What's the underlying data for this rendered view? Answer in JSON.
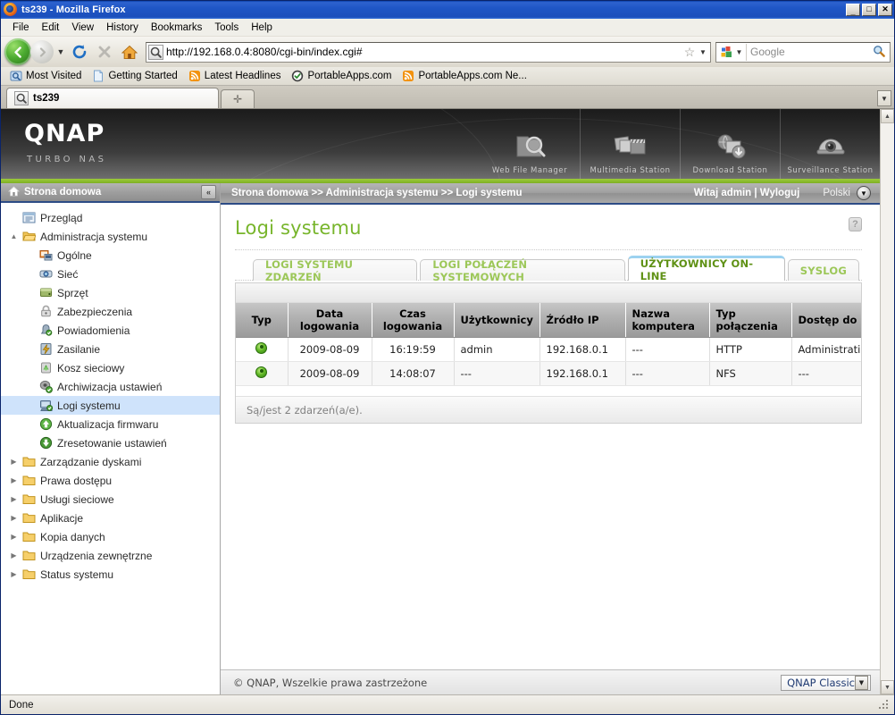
{
  "window": {
    "title": "ts239 - Mozilla Firefox",
    "minimize": "_",
    "maximize": "□",
    "close": "✕"
  },
  "menu": [
    "File",
    "Edit",
    "View",
    "History",
    "Bookmarks",
    "Tools",
    "Help"
  ],
  "toolbar": {
    "back": "◀",
    "forward": "▶",
    "history_arrow": "▼",
    "reload": "⟳",
    "stop": "✕",
    "home": "home-icon",
    "url": "http://192.168.0.4:8080/cgi-bin/index.cgi#",
    "star": "☆",
    "url_dropdown": "▼",
    "search_engine": "Google",
    "search_dropdown": "▼",
    "search_placeholder": "Google"
  },
  "bookmarks": [
    {
      "label": "Most Visited",
      "icon": "magnifier-folder-icon"
    },
    {
      "label": "Getting Started",
      "icon": "page-icon"
    },
    {
      "label": "Latest Headlines",
      "icon": "rss-icon"
    },
    {
      "label": "PortableApps.com",
      "icon": "check-circle-icon"
    },
    {
      "label": "PortableApps.com Ne...",
      "icon": "rss-icon"
    }
  ],
  "browser_tabs": {
    "active": "ts239",
    "new_tab": "✛",
    "list_arrow": "▼"
  },
  "qnap": {
    "logo": "QNAP",
    "tagline": "TURBO NAS",
    "apps": [
      {
        "label": "Web File Manager",
        "icon": "folder-search-icon"
      },
      {
        "label": "Multimedia Station",
        "icon": "photos-clapboard-icon"
      },
      {
        "label": "Download Station",
        "icon": "download-box-icon"
      },
      {
        "label": "Surveillance Station",
        "icon": "dome-camera-icon"
      }
    ]
  },
  "sidebar": {
    "header": "Strona domowa",
    "home_icon": "house-icon",
    "collapse_icon": "«",
    "items": [
      {
        "label": "Przegląd",
        "level": 1,
        "icon": "overview-icon",
        "twisty": "",
        "selected": false
      },
      {
        "label": "Administracja systemu",
        "level": 1,
        "icon": "folder-open-icon",
        "twisty": "▲",
        "selected": false
      },
      {
        "label": "Ogólne",
        "level": 2,
        "icon": "general-icon",
        "twisty": "",
        "selected": false
      },
      {
        "label": "Sieć",
        "level": 2,
        "icon": "network-icon",
        "twisty": "",
        "selected": false
      },
      {
        "label": "Sprzęt",
        "level": 2,
        "icon": "hardware-icon",
        "twisty": "",
        "selected": false
      },
      {
        "label": "Zabezpieczenia",
        "level": 2,
        "icon": "lock-icon",
        "twisty": "",
        "selected": false
      },
      {
        "label": "Powiadomienia",
        "level": 2,
        "icon": "notification-icon",
        "twisty": "",
        "selected": false
      },
      {
        "label": "Zasilanie",
        "level": 2,
        "icon": "power-icon",
        "twisty": "",
        "selected": false
      },
      {
        "label": "Kosz sieciowy",
        "level": 2,
        "icon": "recycle-bin-icon",
        "twisty": "",
        "selected": false
      },
      {
        "label": "Archiwizacja ustawień",
        "level": 2,
        "icon": "backup-icon",
        "twisty": "",
        "selected": false
      },
      {
        "label": "Logi systemu",
        "level": 2,
        "icon": "system-logs-icon",
        "twisty": "",
        "selected": true
      },
      {
        "label": "Aktualizacja firmwaru",
        "level": 2,
        "icon": "firmware-update-icon",
        "twisty": "",
        "selected": false
      },
      {
        "label": "Zresetowanie ustawień",
        "level": 2,
        "icon": "reset-icon",
        "twisty": "",
        "selected": false
      },
      {
        "label": "Zarządzanie dyskami",
        "level": 1,
        "icon": "folder-icon",
        "twisty": "▶",
        "selected": false
      },
      {
        "label": "Prawa dostępu",
        "level": 1,
        "icon": "folder-icon",
        "twisty": "▶",
        "selected": false
      },
      {
        "label": "Usługi sieciowe",
        "level": 1,
        "icon": "folder-icon",
        "twisty": "▶",
        "selected": false
      },
      {
        "label": "Aplikacje",
        "level": 1,
        "icon": "folder-icon",
        "twisty": "▶",
        "selected": false
      },
      {
        "label": "Kopia danych",
        "level": 1,
        "icon": "folder-icon",
        "twisty": "▶",
        "selected": false
      },
      {
        "label": "Urządzenia zewnętrzne",
        "level": 1,
        "icon": "folder-icon",
        "twisty": "▶",
        "selected": false
      },
      {
        "label": "Status systemu",
        "level": 1,
        "icon": "folder-icon",
        "twisty": "▶",
        "selected": false
      }
    ]
  },
  "breadcrumb": {
    "path": "Strona domowa >> Administracja systemu >> Logi systemu",
    "greeting": "Witaj admin | Wyloguj",
    "language": "Polski",
    "lang_arrow": "▼"
  },
  "main": {
    "title": "Logi systemu",
    "help_label": "?",
    "tabs": [
      {
        "label": "LOGI SYSTEMU ZDARZEŃ",
        "active": false
      },
      {
        "label": "LOGI POŁĄCZEŃ SYSTEMOWYCH",
        "active": false
      },
      {
        "label": "UŻYTKOWNICY ON-LINE",
        "active": true
      },
      {
        "label": "SYSLOG",
        "active": false
      }
    ],
    "table": {
      "columns": [
        "Typ",
        "Data logowania",
        "Czas logowania",
        "Użytkownicy",
        "Źródło IP",
        "Nazwa komputera",
        "Typ połączenia",
        "Dostęp do zaso"
      ],
      "rows": [
        {
          "type": "online-user-icon",
          "date": "2009-08-09",
          "time": "16:19:59",
          "user": "admin",
          "source_ip": "192.168.0.1",
          "computer_name": "---",
          "connection_type": "HTTP",
          "resource_access": "Administration"
        },
        {
          "type": "online-user-icon",
          "date": "2009-08-09",
          "time": "14:08:07",
          "user": "---",
          "source_ip": "192.168.0.1",
          "computer_name": "---",
          "connection_type": "NFS",
          "resource_access": "---"
        }
      ],
      "summary": "Są/jest 2 zdarzeń(a/e)."
    }
  },
  "footer": {
    "copyright": "© QNAP, Wszelkie prawa zastrzeżone",
    "theme": "QNAP Classic",
    "theme_arrow": "▼"
  },
  "status": {
    "text": "Done"
  },
  "colors": {
    "qnap_green": "#77b52b",
    "accent_bar": "#9ccb3b",
    "tab_active_top": "#9cd2f0",
    "selection": "#cfe3fb",
    "title_blue": "#1f56c6"
  }
}
